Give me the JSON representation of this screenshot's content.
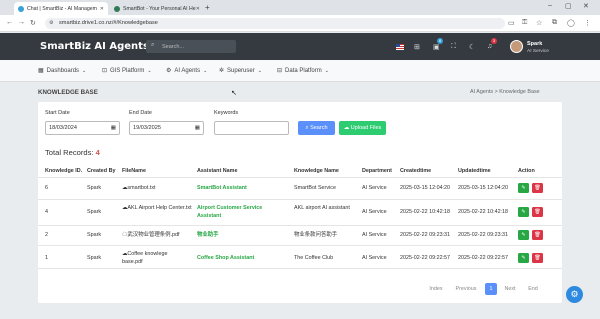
{
  "browser": {
    "tabs": [
      {
        "title": "Chat | SmartBiz - AI Managem",
        "active": true,
        "fav_color": "#3aa0d8"
      },
      {
        "title": "SmartBot - Your Personal AI He",
        "active": false,
        "fav_color": "#2e7d55"
      }
    ],
    "url": "smartbiz.drive1.co.nz/#/Knowledgebase"
  },
  "header": {
    "brand": "SmartBiz AI Agents",
    "search_placeholder": "Search...",
    "badges": [
      "8",
      "3"
    ],
    "user_name": "Spark",
    "user_role": "AI Service"
  },
  "menu": [
    {
      "label": "Dashboards",
      "icon": "grid-icon"
    },
    {
      "label": "GIS Platform",
      "icon": "map-icon"
    },
    {
      "label": "AI Agents",
      "icon": "robot-icon"
    },
    {
      "label": "Superuser",
      "icon": "gear-icon"
    },
    {
      "label": "Data Platform",
      "icon": "database-icon"
    }
  ],
  "page": {
    "title": "KNOWLEDGE BASE",
    "breadcrumb": "AI Agents  >  Knowledge Base"
  },
  "filters": {
    "start_label": "Start Date",
    "start_value": "18/03/2024",
    "end_label": "End Date",
    "end_value": "19/03/2025",
    "keywords_label": "Keywords",
    "keywords_value": "",
    "search_label": "Search",
    "upload_label": "Upload Files",
    "search_color": "#5b8ff9",
    "upload_color": "#2ecc71"
  },
  "total": {
    "label": "Total Records:",
    "count": "4"
  },
  "table": {
    "headers": [
      "Knowledge ID.",
      "Created By",
      "FileName",
      "Assistant Name",
      "Knowledge Name",
      "Department",
      "Createdtime",
      "Updatedtime",
      "Action"
    ],
    "rows": [
      {
        "id": "6",
        "by": "Spark",
        "file": "smartbot.txt",
        "assistant": "SmartBot Assistant",
        "kname": "SmartBot Service",
        "dept": "AI Service",
        "created": "2025-03-15 12:04:20",
        "updated": "2025-03-15 12:04:20"
      },
      {
        "id": "4",
        "by": "Spark",
        "file": "AKL Airport Help Center.txt",
        "assistant": "Airport Customer Service Assistant",
        "kname": "AKL airport AI assistant",
        "dept": "AI Service",
        "created": "2025-02-22 10:42:18",
        "updated": "2025-02-22 10:42:18"
      },
      {
        "id": "2",
        "by": "Spark",
        "file": "武汉物业管理条例.pdf",
        "assistant": "物业助手",
        "kname": "物业条款问答助手",
        "dept": "AI Service",
        "created": "2025-02-22 09:23:31",
        "updated": "2025-02-22 09:23:31"
      },
      {
        "id": "1",
        "by": "Spark",
        "file": "Coffee knowlege base.pdf",
        "assistant": "Coffee Shop Assistant",
        "kname": "The Coffee Club",
        "dept": "AI Service",
        "created": "2025-02-22 09:22:57",
        "updated": "2025-02-22 09:22:57"
      }
    ]
  },
  "pagination": [
    "Index",
    "Previous",
    "1",
    "Next",
    "End"
  ]
}
